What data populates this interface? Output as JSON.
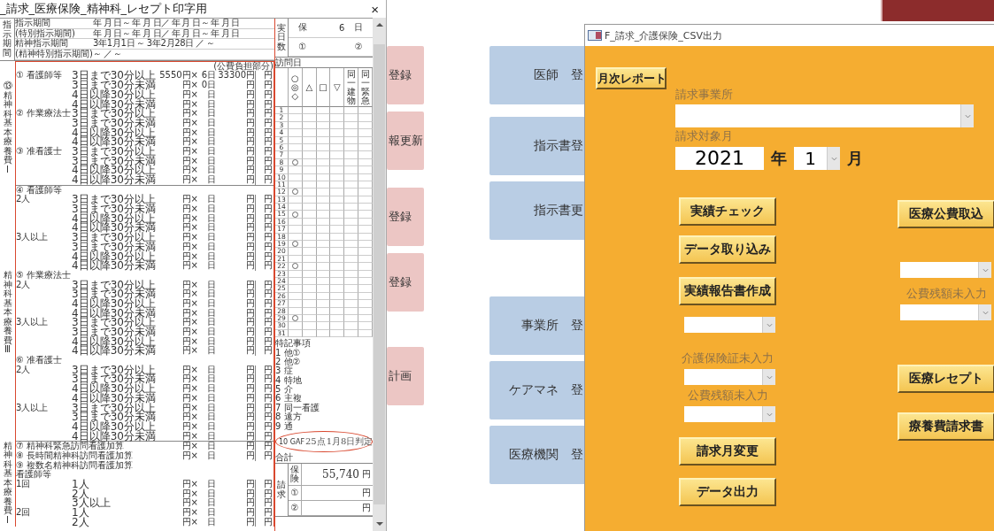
{
  "report": {
    "title": "_請求_医療保険_精神科_レセプト印字用",
    "close": "×",
    "period_label": "指示期間",
    "period_rows": [
      {
        "label": "指示期間",
        "value": "年 月 日～ 年 月 日／ 年 月 日～ 年 月 日"
      },
      {
        "label": "(特別指示期間)",
        "value": "年 月 日～ 年 月 日／ 年 月 日～ 年 月 日"
      },
      {
        "label": "精神指示期間",
        "value": "3年1月1日 ～ 3年2月28日 ／ ～"
      },
      {
        "label": "(精神特別指示期間)",
        "value": "～ ／ ～"
      }
    ],
    "public_header": "(公費負担部分)",
    "sections": [
      {
        "label": "⑬精神科基本療養費Ⅰ",
        "rows": [
          {
            "label": "① 看護師等",
            "item": "3日まで30分以上",
            "price": "5550円×",
            "days": "6日",
            "amount": "33300円",
            "public": "円"
          },
          {
            "item": "3日まで30分未満",
            "price": "円×",
            "days": "0日",
            "amount": "円",
            "public": "円"
          },
          {
            "item": "4日以降30分以上",
            "price": "円×",
            "days": "日",
            "amount": "円",
            "public": "円"
          },
          {
            "item": "4日以降30分未満",
            "price": "円×",
            "days": "日",
            "amount": "円",
            "public": "円"
          },
          {
            "label": "② 作業療法士",
            "item": "3日まで30分以上",
            "price": "円×",
            "days": "日",
            "amount": "円",
            "public": "円"
          },
          {
            "item": "3日まで30分未満",
            "price": "円×",
            "days": "日",
            "amount": "円",
            "public": "円"
          },
          {
            "item": "4日以降30分以上",
            "price": "円×",
            "days": "日",
            "amount": "円",
            "public": "円"
          },
          {
            "item": "4日以降30分未満",
            "price": "円×",
            "days": "日",
            "amount": "円",
            "public": "円"
          },
          {
            "label": "③ 准看護士",
            "item": "3日まで30分以上",
            "price": "円×",
            "days": "日",
            "amount": "円",
            "public": "円"
          },
          {
            "item": "3日まで30分未満",
            "price": "円×",
            "days": "日",
            "amount": "円",
            "public": "円"
          },
          {
            "item": "4日以降30分以上",
            "price": "円×",
            "days": "日",
            "amount": "円",
            "public": "円"
          },
          {
            "item": "4日以降30分未満",
            "price": "円×",
            "days": "日",
            "amount": "円",
            "public": "円"
          }
        ]
      },
      {
        "label": "精神科基本療養費Ⅲ",
        "rows": [
          {
            "header": "④ 看護師等"
          },
          {
            "label": "2人",
            "item": "3日まで30分以上",
            "price": "円×",
            "days": "日",
            "amount": "円",
            "public": "円"
          },
          {
            "item": "3日まで30分未満",
            "price": "円×",
            "days": "日",
            "amount": "円",
            "public": "円"
          },
          {
            "item": "4日以降30分以上",
            "price": "円×",
            "days": "日",
            "amount": "円",
            "public": "円"
          },
          {
            "item": "4日以降30分未満",
            "price": "円×",
            "days": "日",
            "amount": "円",
            "public": "円"
          },
          {
            "label": "3人以上",
            "item": "3日まで30分以上",
            "price": "円×",
            "days": "日",
            "amount": "円",
            "public": "円"
          },
          {
            "item": "3日まで30分未満",
            "price": "円×",
            "days": "日",
            "amount": "円",
            "public": "円"
          },
          {
            "item": "4日以降30分以上",
            "price": "円×",
            "days": "日",
            "amount": "円",
            "public": "円"
          },
          {
            "item": "4日以降30分未満",
            "price": "円×",
            "days": "日",
            "amount": "円",
            "public": "円"
          },
          {
            "header": "⑤ 作業療法士"
          },
          {
            "label": "2人",
            "item": "3日まで30分以上",
            "price": "円×",
            "days": "日",
            "amount": "円",
            "public": "円"
          },
          {
            "item": "3日まで30分未満",
            "price": "円×",
            "days": "日",
            "amount": "円",
            "public": "円"
          },
          {
            "item": "4日以降30分以上",
            "price": "円×",
            "days": "日",
            "amount": "円",
            "public": "円"
          },
          {
            "item": "4日以降30分未満",
            "price": "円×",
            "days": "日",
            "amount": "円",
            "public": "円"
          },
          {
            "label": "3人以上",
            "item": "3日まで30分以上",
            "price": "円×",
            "days": "日",
            "amount": "円",
            "public": "円"
          },
          {
            "item": "3日まで30分未満",
            "price": "円×",
            "days": "日",
            "amount": "円",
            "public": "円"
          },
          {
            "item": "4日以降30分以上",
            "price": "円×",
            "days": "日",
            "amount": "円",
            "public": "円"
          },
          {
            "item": "4日以降30分未満",
            "price": "円×",
            "days": "日",
            "amount": "円",
            "public": "円"
          },
          {
            "header": "⑥ 准看護士"
          },
          {
            "label": "2人",
            "item": "3日まで30分以上",
            "price": "円×",
            "days": "日",
            "amount": "円",
            "public": "円"
          },
          {
            "item": "3日まで30分未満",
            "price": "円×",
            "days": "日",
            "amount": "円",
            "public": "円"
          },
          {
            "item": "4日以降30分以上",
            "price": "円×",
            "days": "日",
            "amount": "円",
            "public": "円"
          },
          {
            "item": "4日以降30分未満",
            "price": "円×",
            "days": "日",
            "amount": "円",
            "public": "円"
          },
          {
            "label": "3人以上",
            "item": "3日まで30分以上",
            "price": "円×",
            "days": "日",
            "amount": "円",
            "public": "円"
          },
          {
            "item": "3日まで30分未満",
            "price": "円×",
            "days": "日",
            "amount": "円",
            "public": "円"
          },
          {
            "item": "4日以降30分以上",
            "price": "円×",
            "days": "日",
            "amount": "円",
            "public": "円"
          },
          {
            "item": "4日以降30分未満",
            "price": "円×",
            "days": "日",
            "amount": "円",
            "public": "円"
          }
        ]
      },
      {
        "label": "精神科基本療養費Ⅰ",
        "rows": [
          {
            "label": "⑦ 精神科緊急訪問看護加算",
            "price": "円×",
            "days": "日",
            "amount": "円",
            "public": "円"
          },
          {
            "label": "⑧ 長時間精神科訪問看護加算",
            "price": "円×",
            "days": "日",
            "amount": "円",
            "public": "円"
          },
          {
            "header": "⑨ 複数名精神科訪問看護加算"
          },
          {
            "header": "看護師等"
          },
          {
            "label": "1回",
            "item": "1人",
            "price": "円×",
            "days": "日",
            "amount": "円",
            "public": "円"
          },
          {
            "item": "2人",
            "price": "円×",
            "days": "日",
            "amount": "円",
            "public": "円"
          },
          {
            "item": "3人以上",
            "price": "円×",
            "days": "日",
            "amount": "円",
            "public": "円"
          },
          {
            "label": "2回",
            "item": "1人",
            "price": "円×",
            "days": "日",
            "amount": "円",
            "public": "円"
          },
          {
            "item": "2人",
            "price": "円×",
            "days": "日",
            "amount": "円",
            "public": "円"
          }
        ]
      }
    ],
    "days_box": {
      "label": "実日数",
      "ins_label": "保",
      "ins_value": "6",
      "ins_unit": "日",
      "p1": "①",
      "p2": "②"
    },
    "visit_label": "訪問日",
    "visit_symbols": [
      "○◎◇",
      "△",
      "□",
      "▽",
      "同一建物",
      "同一緊急"
    ],
    "days": [
      {
        "day": "1",
        "visited": false
      },
      {
        "day": "2",
        "visited": false
      },
      {
        "day": "3",
        "visited": false
      },
      {
        "day": "4",
        "visited": false
      },
      {
        "day": "5",
        "visited": false
      },
      {
        "day": "6",
        "visited": false
      },
      {
        "day": "7",
        "visited": false
      },
      {
        "day": "8",
        "visited": true
      },
      {
        "day": "9",
        "visited": false
      },
      {
        "day": "10",
        "visited": false
      },
      {
        "day": "11",
        "visited": false
      },
      {
        "day": "12",
        "visited": true
      },
      {
        "day": "13",
        "visited": false
      },
      {
        "day": "14",
        "visited": false
      },
      {
        "day": "15",
        "visited": true
      },
      {
        "day": "16",
        "visited": false
      },
      {
        "day": "17",
        "visited": false
      },
      {
        "day": "18",
        "visited": false
      },
      {
        "day": "19",
        "visited": true
      },
      {
        "day": "20",
        "visited": false
      },
      {
        "day": "21",
        "visited": false
      },
      {
        "day": "22",
        "visited": true
      },
      {
        "day": "23",
        "visited": false
      },
      {
        "day": "24",
        "visited": false
      },
      {
        "day": "25",
        "visited": false
      },
      {
        "day": "26",
        "visited": false
      },
      {
        "day": "27",
        "visited": false
      },
      {
        "day": "28",
        "visited": false
      },
      {
        "day": "29",
        "visited": true
      },
      {
        "day": "30",
        "visited": false
      },
      {
        "day": "31",
        "visited": false
      }
    ],
    "notes": [
      "特記事項",
      "1 他①",
      "2 他②",
      "3 症",
      "4 特地",
      "5 介",
      "6 主複",
      "7 同一看護",
      "8 遠方",
      "9 通"
    ],
    "gaf": {
      "label": "10 GAF",
      "points": "25点",
      "date": "1月8日判定"
    },
    "total_label": "合計",
    "claim": {
      "label": "請求",
      "rows": [
        {
          "label": "保険",
          "value": "55,740",
          "unit": "円"
        },
        {
          "label": "①",
          "unit": "円"
        },
        {
          "label": "②",
          "unit": "円"
        }
      ]
    }
  },
  "background": {
    "left_buttons": [
      "登録",
      "報更新",
      "登録",
      "登録",
      "計画"
    ],
    "right_buttons": [
      "医師　登",
      "指示書登",
      "指示書更",
      "事業所　登",
      "ケアマネ　登",
      "医療機関　登"
    ]
  },
  "form": {
    "title": "F_請求_介護保険_CSV出力",
    "report_button": "月次レポート",
    "office_label": "請求事業所",
    "month_label": "請求対象月",
    "year": "2021",
    "year_unit": "年",
    "month": "1",
    "month_unit": "月",
    "left": [
      {
        "kind": "button",
        "label": "実績チェック"
      },
      {
        "kind": "button",
        "label": "データ取り込み"
      },
      {
        "kind": "button",
        "label": "実績報告書作成"
      },
      {
        "kind": "combo"
      },
      {
        "kind": "label",
        "label": "介護保険証未入力"
      },
      {
        "kind": "combo"
      },
      {
        "kind": "label",
        "label": "公費残額未入力"
      },
      {
        "kind": "combo"
      },
      {
        "kind": "button",
        "label": "請求月変更"
      },
      {
        "kind": "button",
        "label": "データ出力"
      }
    ],
    "right": [
      {
        "kind": "button",
        "label": "医療公費取込"
      },
      {
        "kind": "combo"
      },
      {
        "kind": "label",
        "label": "公費残額未入力"
      },
      {
        "kind": "combo"
      },
      {
        "kind": "button",
        "label": "医療レセプト"
      },
      {
        "kind": "button",
        "label": "療養費請求書"
      }
    ]
  }
}
